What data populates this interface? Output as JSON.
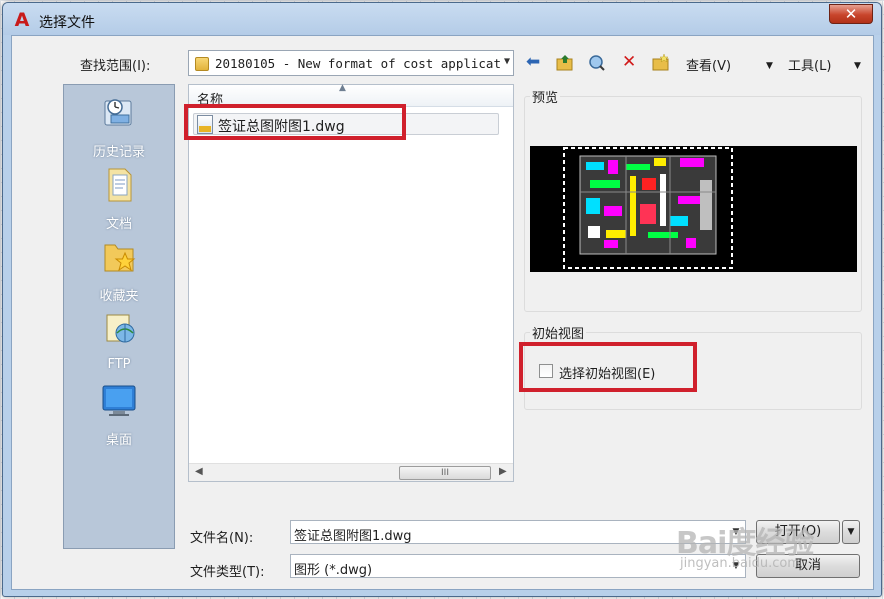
{
  "window": {
    "title": "选择文件",
    "close_glyph": "✕"
  },
  "lookin": {
    "label": "查找范围(I):",
    "value": "20180105 - New format of cost applicat"
  },
  "toolbar": {
    "icons": [
      "back-arrow-icon",
      "up-folder-icon",
      "search-web-icon",
      "delete-icon",
      "new-folder-icon"
    ],
    "view_label": "查看(V)",
    "tools_label": "工具(L)"
  },
  "places": [
    {
      "label": "历史记录",
      "icon": "history-icon"
    },
    {
      "label": "文档",
      "icon": "documents-folder-icon"
    },
    {
      "label": "收藏夹",
      "icon": "favorites-folder-icon"
    },
    {
      "label": "FTP",
      "icon": "ftp-icon"
    },
    {
      "label": "桌面",
      "icon": "desktop-icon"
    }
  ],
  "filelist": {
    "column_name": "名称",
    "files": [
      {
        "name": "签证总图附图1.dwg",
        "icon": "dwg-file-icon"
      }
    ],
    "scroll_thumb": "III"
  },
  "preview": {
    "title": "预览"
  },
  "initial_view": {
    "title": "初始视图",
    "checkbox_label": "选择初始视图(E)",
    "checked": false
  },
  "filename": {
    "label": "文件名(N):",
    "value": "签证总图附图1.dwg"
  },
  "filetype": {
    "label": "文件类型(T):",
    "value": "图形 (*.dwg)"
  },
  "buttons": {
    "open": "打开(O)",
    "cancel": "取消"
  },
  "watermark": {
    "brand": "Bai度经验",
    "url": "jingyan.baidu.com"
  },
  "colors": {
    "highlight_frame": "#d0202c",
    "titlebar": "#b8d0ea",
    "close_button": "#c8452c"
  }
}
